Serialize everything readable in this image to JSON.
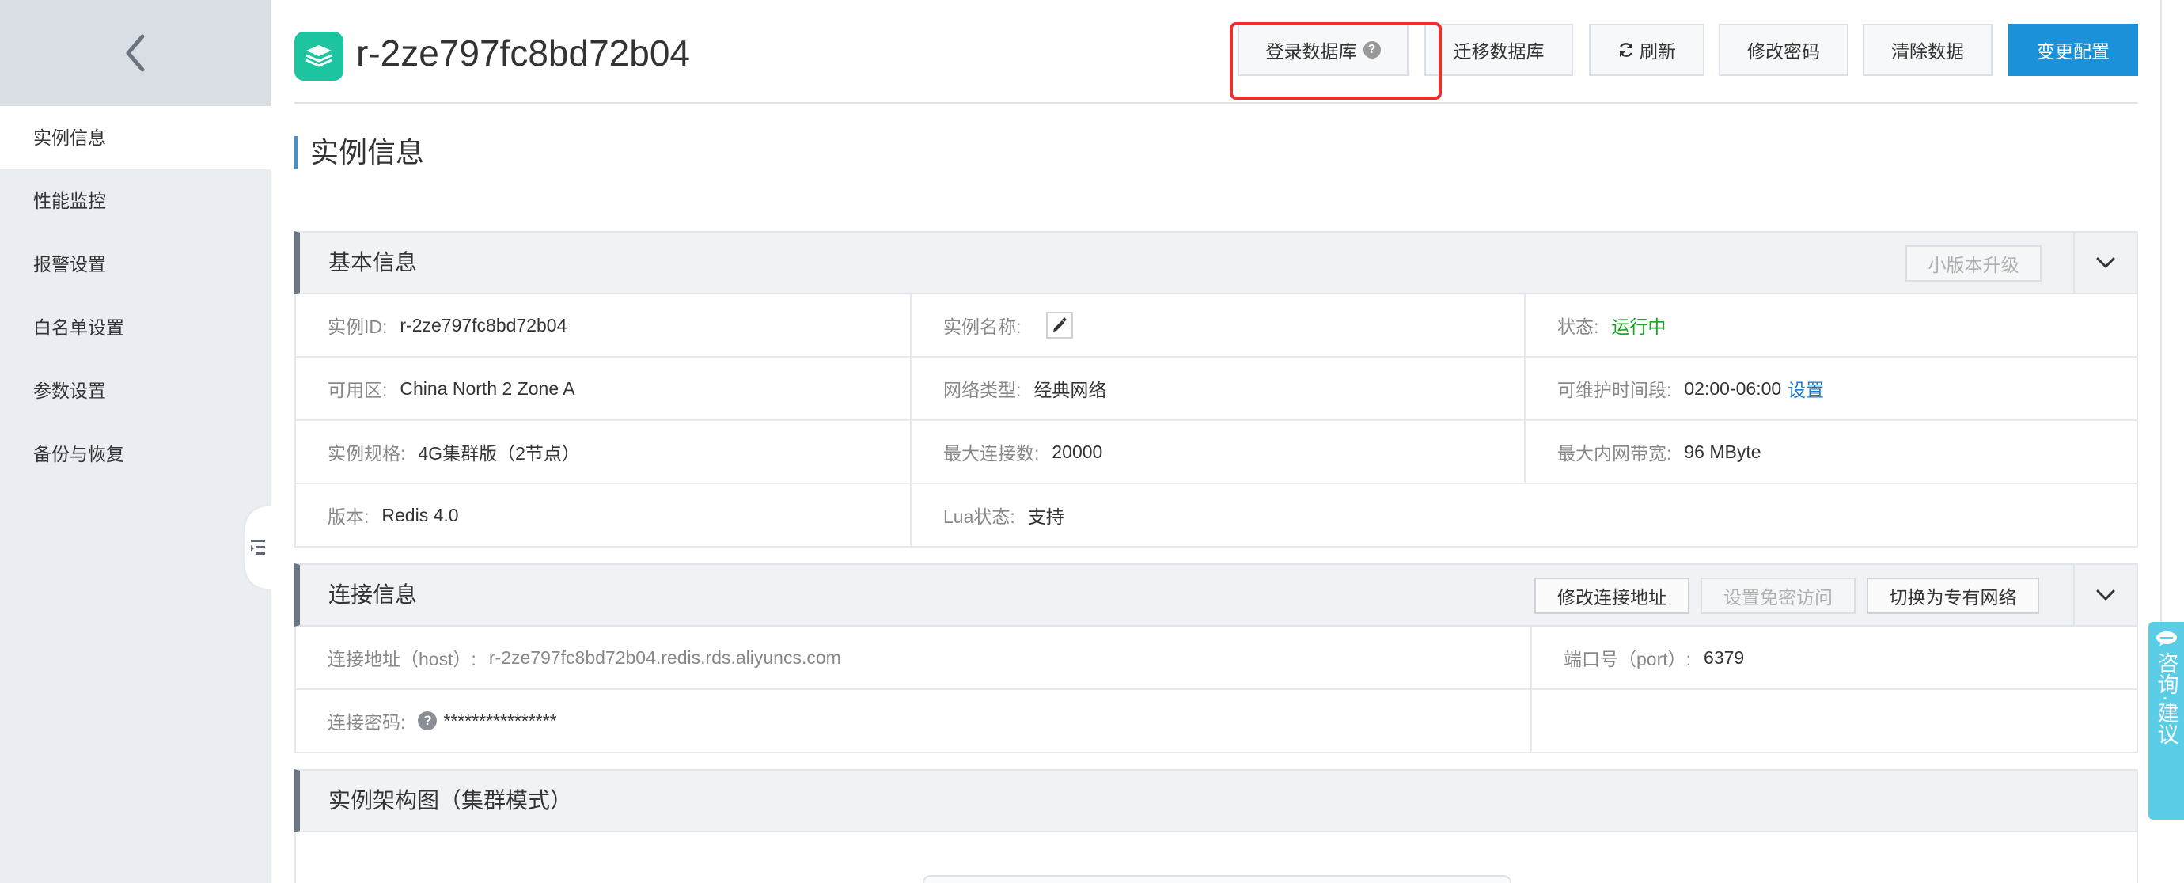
{
  "sidebar": {
    "items": [
      {
        "label": "实例信息",
        "active": true
      },
      {
        "label": "性能监控",
        "active": false
      },
      {
        "label": "报警设置",
        "active": false
      },
      {
        "label": "白名单设置",
        "active": false
      },
      {
        "label": "参数设置",
        "active": false
      },
      {
        "label": "备份与恢复",
        "active": false
      }
    ]
  },
  "header": {
    "instance_title": "r-2ze797fc8bd72b04",
    "buttons": {
      "login_db": "登录数据库",
      "migrate_db": "迁移数据库",
      "refresh": "刷新",
      "change_password": "修改密码",
      "clear_data": "清除数据",
      "change_config": "变更配置"
    },
    "help_mark": "?"
  },
  "page_title": "实例信息",
  "basic_info": {
    "title": "基本信息",
    "upgrade_button": "小版本升级",
    "instance_id_label": "实例ID:",
    "instance_id": "r-2ze797fc8bd72b04",
    "instance_name_label": "实例名称:",
    "status_label": "状态:",
    "status": "运行中",
    "zone_label": "可用区:",
    "zone": "China North 2 Zone A",
    "network_type_label": "网络类型:",
    "network_type": "经典网络",
    "maintenance_label": "可维护时间段:",
    "maintenance": "02:00-06:00",
    "maintenance_link": "设置",
    "spec_label": "实例规格:",
    "spec": "4G集群版（2节点）",
    "max_conn_label": "最大连接数:",
    "max_conn": "20000",
    "bandwidth_label": "最大内网带宽:",
    "bandwidth": "96 MByte",
    "version_label": "版本:",
    "version": "Redis 4.0",
    "lua_label": "Lua状态:",
    "lua": "支持"
  },
  "connection_info": {
    "title": "连接信息",
    "buttons": {
      "modify_address": "修改连接地址",
      "passwordless": "设置免密访问",
      "switch_vpc": "切换为专有网络"
    },
    "host_label": "连接地址（host）:",
    "host": "r-2ze797fc8bd72b04.redis.rds.aliyuncs.com",
    "port_label": "端口号（port）:",
    "port": "6379",
    "password_label": "连接密码:",
    "password": "****************",
    "help_mark": "?"
  },
  "architecture": {
    "title": "实例架构图（集群模式）"
  },
  "feedback": {
    "label": "咨询·建议"
  },
  "colors": {
    "primary_button": "#1a91d9",
    "status_running": "#1aa323",
    "link": "#1a78c8",
    "highlight": "#e8312f",
    "feedback_tab": "#5bcde7",
    "instance_icon": "#1cc5a0"
  }
}
